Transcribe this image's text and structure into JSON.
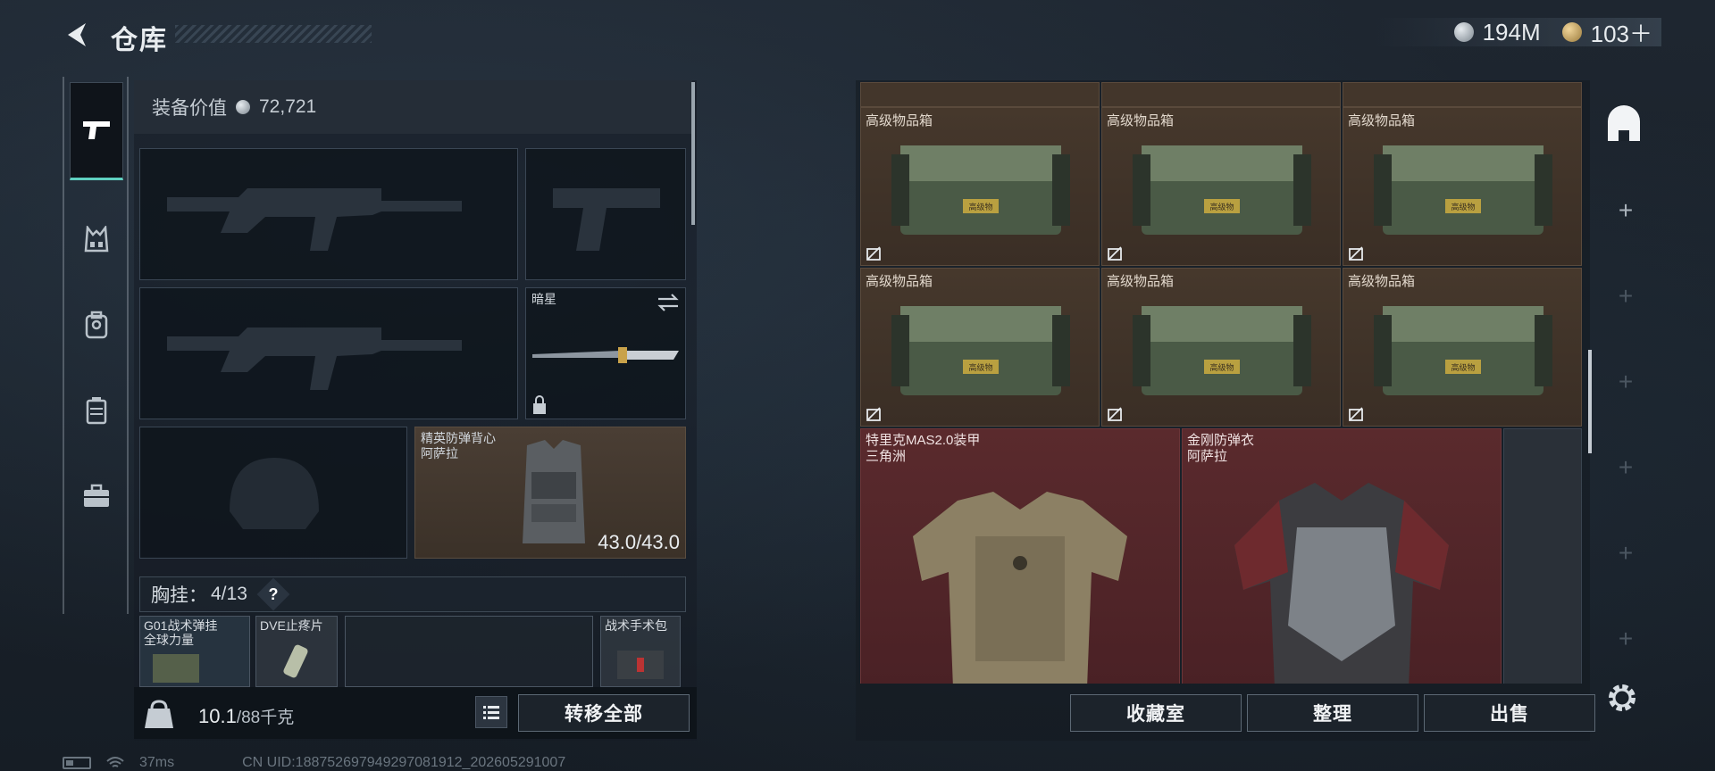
{
  "header": {
    "title": "仓库",
    "currency_silver": "194M",
    "currency_gold": "103＋"
  },
  "left_nav": {
    "items": [
      {
        "name": "pistol-icon",
        "active": true
      },
      {
        "name": "chest-rig-icon"
      },
      {
        "name": "backpack-icon"
      },
      {
        "name": "container-icon"
      },
      {
        "name": "briefcase-icon"
      }
    ]
  },
  "loadout": {
    "value_label": "装备价值",
    "value": "72,721",
    "melee_name": "暗星",
    "vest_name": "精英防弹背心",
    "vest_origin": "阿萨拉",
    "vest_durability": "43.0/43.0",
    "chest_rig_label": "胸挂：",
    "chest_rig_count": "4/13",
    "help_label": "?",
    "small_items": [
      {
        "line1": "G01战术弹挂",
        "line2": "全球力量"
      },
      {
        "line1": "DVE止疼片",
        "line2": ""
      },
      {
        "line1": "战术手术包",
        "line2": ""
      }
    ],
    "weight": "10.1",
    "weight_max": "/88千克",
    "transfer_all": "转移全部"
  },
  "stash": {
    "crate_label": "高级物品箱",
    "crate_stamp": "高级物",
    "armors": [
      {
        "line1": "特里克MAS2.0装甲",
        "line2": "三角洲"
      },
      {
        "line1": "金刚防弹衣",
        "line2": "阿萨拉"
      }
    ],
    "btn_collection": "收藏室",
    "btn_sort": "整理",
    "btn_sell": "出售"
  },
  "status_bar": {
    "ping": "37ms",
    "uid": "CN UID:1887526979492970819​12_202605291007"
  }
}
